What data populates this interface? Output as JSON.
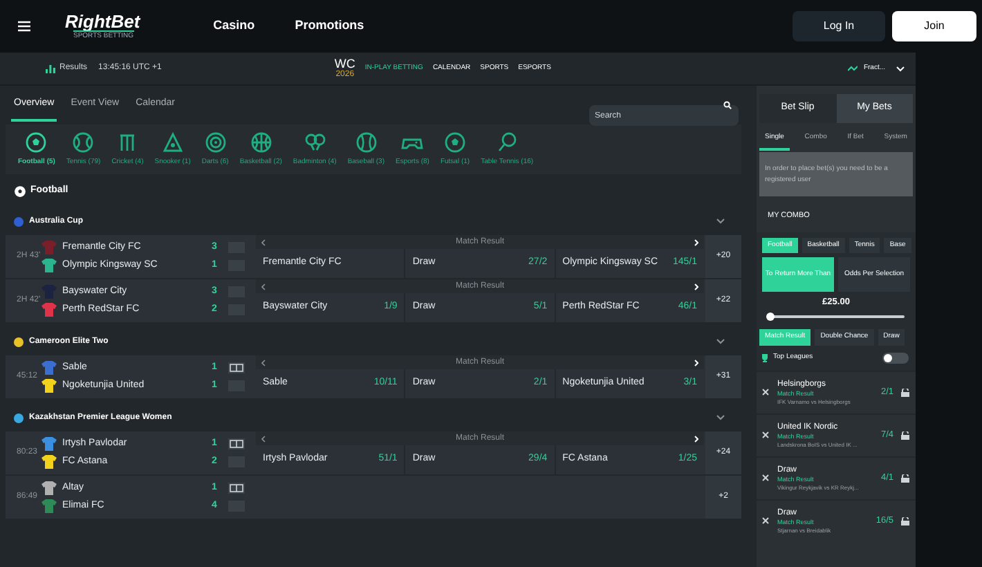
{
  "header": {
    "logo": "RightBet",
    "tagline": "SPORTS BETTING",
    "nav": [
      "Casino",
      "Promotions"
    ],
    "login": "Log In",
    "join": "Join"
  },
  "subbar": {
    "results": "Results",
    "time": "13:45:16 UTC +1",
    "wc": "WC",
    "year": "2026",
    "links": [
      {
        "label": "IN-PLAY BETTING",
        "selected": true
      },
      {
        "label": "CALENDAR",
        "selected": false
      },
      {
        "label": "SPORTS",
        "selected": false
      },
      {
        "label": "ESPORTS",
        "selected": false
      }
    ],
    "odds_format": "Fract..."
  },
  "tabs": [
    {
      "label": "Overview",
      "selected": true
    },
    {
      "label": "Event View",
      "selected": false
    },
    {
      "label": "Calendar",
      "selected": false
    }
  ],
  "search": {
    "placeholder": "Search"
  },
  "sports": [
    {
      "kind": "football",
      "label": "Football (5)",
      "selected": true
    },
    {
      "kind": "tennis",
      "label": "Tennis (79)",
      "selected": false
    },
    {
      "kind": "cricket",
      "label": "Cricket (4)",
      "selected": false
    },
    {
      "kind": "snooker",
      "label": "Snooker (1)",
      "selected": false
    },
    {
      "kind": "darts",
      "label": "Darts (6)",
      "selected": false
    },
    {
      "kind": "basketball",
      "label": "Basketball (2)",
      "selected": false
    },
    {
      "kind": "badminton",
      "label": "Badminton (4)",
      "selected": false
    },
    {
      "kind": "baseball",
      "label": "Baseball (3)",
      "selected": false
    },
    {
      "kind": "esports",
      "label": "Esports (8)",
      "selected": false
    },
    {
      "kind": "futsal",
      "label": "Futsal (1)",
      "selected": false
    },
    {
      "kind": "table-tennis",
      "label": "Table Tennis (16)",
      "selected": false
    }
  ],
  "section": "Football",
  "leagues": [
    {
      "name": "Australia Cup",
      "color": "#2f5fd0",
      "matches": [
        {
          "time": "2H 43'",
          "stats": false,
          "home": {
            "name": "Fremantle City FC",
            "score": "3",
            "color": "#7a1f2a"
          },
          "away": {
            "name": "Olympic Kingsway SC",
            "score": "1",
            "color": "#2bb58e"
          },
          "market": "Match Result",
          "odds": [
            {
              "label": "Fremantle City FC"
            },
            {
              "label": "Draw",
              "price": "27/2"
            },
            {
              "label": "Olympic Kingsway SC",
              "price": "145/1"
            }
          ],
          "more": "+20"
        },
        {
          "time": "2H 42'",
          "stats": false,
          "home": {
            "name": "Bayswater City",
            "score": "3",
            "color": "#1c2340"
          },
          "away": {
            "name": "Perth RedStar FC",
            "score": "2",
            "color": "#e0334a"
          },
          "market": "Match Result",
          "odds": [
            {
              "label": "Bayswater City",
              "price": "1/9"
            },
            {
              "label": "Draw",
              "price": "5/1"
            },
            {
              "label": "Perth RedStar FC",
              "price": "46/1"
            }
          ],
          "more": "+22"
        }
      ]
    },
    {
      "name": "Cameroon Elite Two",
      "color": "#e8c12a",
      "matches": [
        {
          "time": "45:12",
          "stats": true,
          "home": {
            "name": "Sable",
            "score": "1",
            "color": "#3a6fd0"
          },
          "away": {
            "name": "Ngoketunjia United",
            "score": "1",
            "color": "#f2d21b"
          },
          "market": "Match Result",
          "odds": [
            {
              "label": "Sable",
              "price": "10/11"
            },
            {
              "label": "Draw",
              "price": "2/1"
            },
            {
              "label": "Ngoketunjia United",
              "price": "3/1"
            }
          ],
          "more": "+31"
        }
      ]
    },
    {
      "name": "Kazakhstan Premier League Women",
      "color": "#3aa8e0",
      "matches": [
        {
          "time": "80:23",
          "stats": true,
          "home": {
            "name": "Irtysh Pavlodar",
            "score": "1",
            "color": "#3a8fe0"
          },
          "away": {
            "name": "FC Astana",
            "score": "2",
            "color": "#f2d21b"
          },
          "market": "Match Result",
          "odds": [
            {
              "label": "Irtysh Pavlodar",
              "price": "51/1"
            },
            {
              "label": "Draw",
              "price": "29/4"
            },
            {
              "label": "FC Astana",
              "price": "1/25"
            }
          ],
          "more": "+24"
        },
        {
          "time": "86:49",
          "stats": true,
          "home": {
            "name": "Altay",
            "score": "1",
            "color": "#b0b0b0"
          },
          "away": {
            "name": "Elimai FC",
            "score": "4",
            "color": "#2e8b57"
          },
          "more": "+2"
        }
      ]
    }
  ],
  "betslip": {
    "tabs": [
      {
        "label": "Bet Slip",
        "selected": false
      },
      {
        "label": "My Bets",
        "selected": true
      }
    ],
    "bet_types": [
      {
        "label": "Single",
        "selected": true
      },
      {
        "label": "Combo",
        "selected": false
      },
      {
        "label": "If Bet",
        "selected": false
      },
      {
        "label": "System",
        "selected": false
      }
    ],
    "message": "In order to place bet(s) you need to be a registered user"
  },
  "combo": {
    "title": "MY COMBO",
    "sports": [
      {
        "label": "Football",
        "selected": true
      },
      {
        "label": "Basketball",
        "selected": false
      },
      {
        "label": "Tennis",
        "selected": false
      },
      {
        "label": "Base",
        "selected": false
      }
    ],
    "modes": [
      {
        "label": "To Return More Than",
        "selected": true
      },
      {
        "label": "Odds Per Selection",
        "selected": false
      }
    ],
    "amount": "£25.00",
    "slider": {
      "level": 0.02
    },
    "markets": [
      {
        "label": "Match Result",
        "selected": true
      },
      {
        "label": "Double Chance",
        "selected": false
      },
      {
        "label": "Draw",
        "selected": false
      }
    ],
    "top_leagues": {
      "label": "Top Leagues",
      "on": false
    },
    "bets": [
      {
        "selection": "Helsingborgs",
        "market": "Match Result",
        "event": "IFK Varnamo vs Helsingborgs",
        "price": "2/1"
      },
      {
        "selection": "United IK Nordic",
        "market": "Match Result",
        "event": "Landskrona BoIS vs United IK ...",
        "price": "7/4"
      },
      {
        "selection": "Draw",
        "market": "Match Result",
        "event": "Vikingur Reykjavik vs KR Reykj...",
        "price": "4/1"
      },
      {
        "selection": "Draw",
        "market": "Match Result",
        "event": "Stjarnan vs Breidablik",
        "price": "16/5"
      }
    ]
  }
}
